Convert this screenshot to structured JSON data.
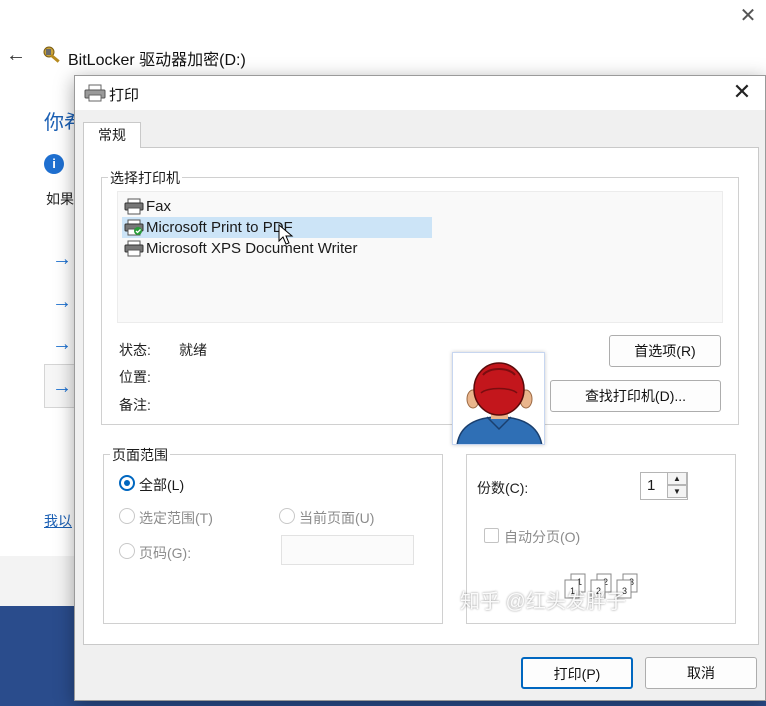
{
  "background_window": {
    "title": "BitLocker 驱动器加密(D:)",
    "heading": "你希",
    "description": "如果",
    "link": "我以",
    "close_icon": "close-icon",
    "back_icon": "arrow-left-icon"
  },
  "dialog": {
    "title": "打印",
    "tab_label": "常规",
    "select_printer": {
      "group_title": "选择打印机",
      "printers": [
        {
          "name": "Fax",
          "selected": false,
          "icon": "printer-icon"
        },
        {
          "name": "Microsoft Print to PDF",
          "selected": true,
          "icon": "printer-default-icon"
        },
        {
          "name": "Microsoft XPS Document Writer",
          "selected": false,
          "icon": "printer-icon"
        }
      ],
      "status_label": "状态:",
      "status_value": "就绪",
      "location_label": "位置:",
      "comment_label": "备注:",
      "preferences_button": "首选项(R)",
      "find_printer_button": "查找打印机(D)..."
    },
    "page_range": {
      "group_title": "页面范围",
      "all_label": "全部(L)",
      "selection_label": "选定范围(T)",
      "current_page_label": "当前页面(U)",
      "pages_label": "页码(G):",
      "pages_value": ""
    },
    "copies": {
      "label": "份数(C):",
      "value": "1",
      "collate_label": "自动分页(O)"
    },
    "print_button": "打印(P)",
    "cancel_button": "取消"
  },
  "watermark": "知乎 @红头发胖子",
  "colors": {
    "accent": "#0067c0",
    "selection": "#cce4f7",
    "desktop": "#2a4c8c"
  }
}
